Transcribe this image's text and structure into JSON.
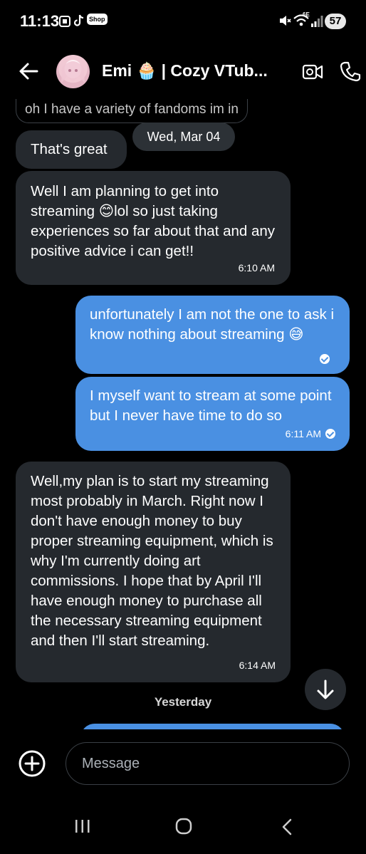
{
  "status_bar": {
    "time": "11:13",
    "shop_label": "Shop",
    "network": "6E",
    "battery": "57"
  },
  "header": {
    "title": "Emi 🧁 | Cozy VTub...",
    "back_icon": "arrow-left-icon",
    "video_icon": "video-camera-icon",
    "phone_icon": "phone-icon"
  },
  "quoted_message": "oh I have a variety of fandoms im in",
  "date_separator": "Wed, Mar 04",
  "messages": [
    {
      "sender": "them",
      "text": "That's great"
    },
    {
      "sender": "them",
      "text": "Well I am planning to get into streaming 😊lol so just taking experiences so far about that and any positive advice i can get!!",
      "time": "6:10 AM"
    },
    {
      "sender": "me",
      "text": "unfortunately I am not the one to ask i know nothing about streaming 😅"
    },
    {
      "sender": "me",
      "text": "I myself want to stream at some point but I never have time to do so",
      "time": "6:11 AM"
    },
    {
      "sender": "them",
      "text": "Well,my plan is to start my streaming most probably in March. Right now I don't have enough money to buy proper streaming equipment, which is why I'm currently doing art commissions. I hope that by April I'll have enough money to purchase all the necessary streaming equipment and then I'll start streaming.",
      "time": "6:14 AM"
    }
  ],
  "yesterday_separator": "Yesterday",
  "composer": {
    "placeholder": "Message"
  },
  "colors": {
    "background": "#000000",
    "incoming_bubble": "#25292e",
    "outgoing_bubble": "#4a90e2"
  }
}
